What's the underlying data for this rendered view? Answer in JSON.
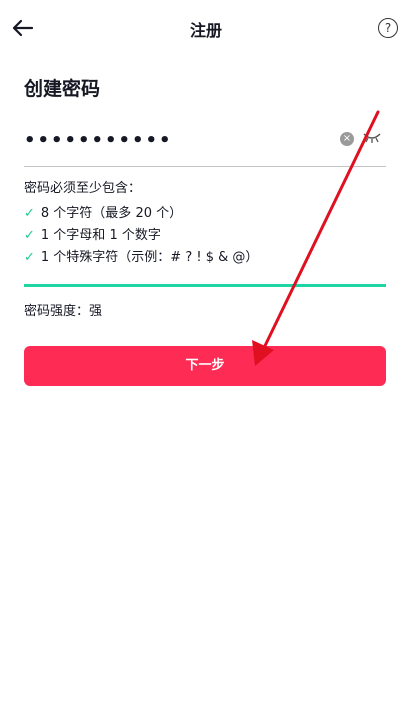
{
  "header": {
    "title": "注册",
    "help_glyph": "?"
  },
  "form": {
    "heading": "创建密码",
    "password_value": "•••••••••••",
    "clear_glyph": "×"
  },
  "requirements": {
    "title": "密码必须至少包含：",
    "check_glyph": "✓",
    "items": [
      "8 个字符（最多 20 个）",
      "1 个字母和 1 个数字",
      "1 个特殊字符（示例：# ? ! $ & @）"
    ]
  },
  "strength": {
    "text": "密码强度：强",
    "color": "#20d5a4"
  },
  "next_button": {
    "label": "下一步",
    "color": "#fe2c55"
  },
  "annotation": {
    "arrow_color": "#e01020"
  }
}
